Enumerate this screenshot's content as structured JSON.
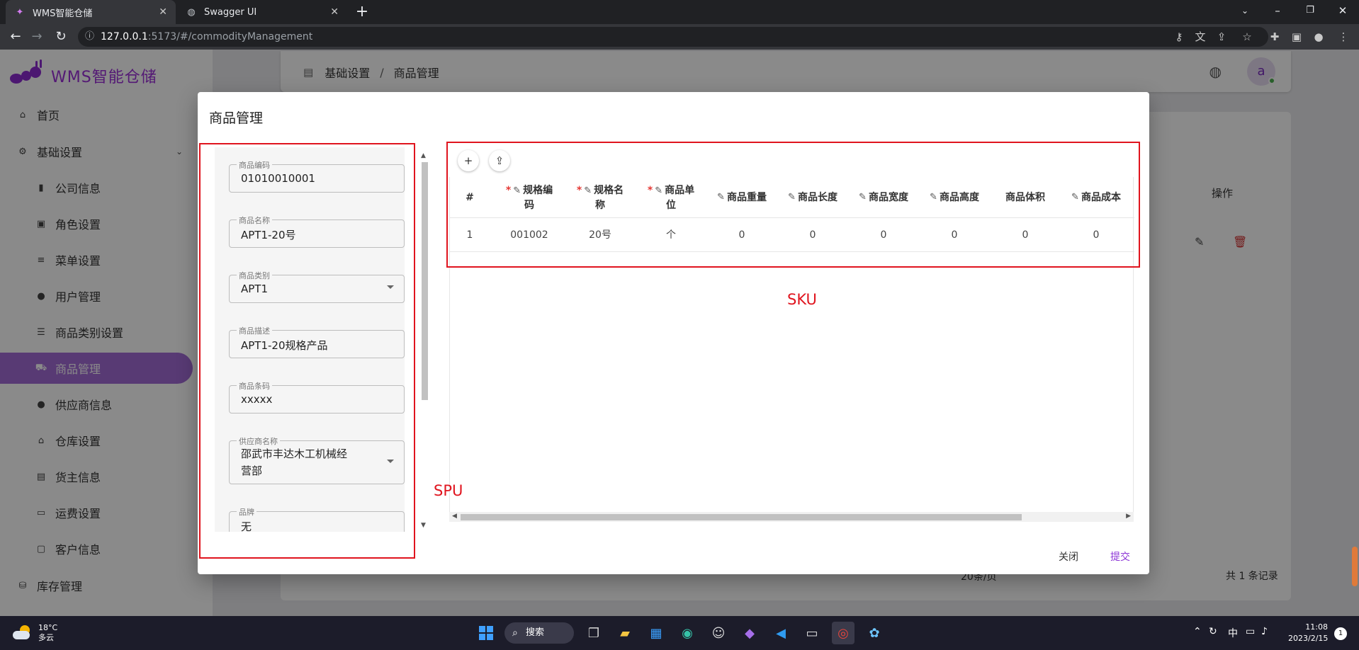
{
  "browser": {
    "tabs": [
      {
        "title": "WMS智能仓储",
        "icon": "ant-icon",
        "active": true
      },
      {
        "title": "Swagger UI",
        "icon": "globe-icon",
        "active": false
      }
    ],
    "url_host": "127.0.0.1",
    "url_rest": ":5173/#/commodityManagement"
  },
  "app": {
    "logo_text": "WMS智能仓储",
    "breadcrumb": [
      "基础设置",
      "商品管理"
    ],
    "avatar_letter": "a",
    "ops_header": "操作",
    "pager_total": "共 1 条记录",
    "pager_size": "20条/页"
  },
  "sidebar": {
    "items": [
      {
        "label": "首页",
        "icon": "home-icon",
        "level": "top"
      },
      {
        "label": "基础设置",
        "icon": "gear-icon",
        "level": "top",
        "expanded": true
      },
      {
        "label": "公司信息",
        "icon": "building-icon",
        "level": "sub"
      },
      {
        "label": "角色设置",
        "icon": "id-card-icon",
        "level": "sub"
      },
      {
        "label": "菜单设置",
        "icon": "menu-icon",
        "level": "sub"
      },
      {
        "label": "用户管理",
        "icon": "person-icon",
        "level": "sub"
      },
      {
        "label": "商品类别设置",
        "icon": "list-icon",
        "level": "sub"
      },
      {
        "label": "商品管理",
        "icon": "cart-icon",
        "level": "sub",
        "active": true
      },
      {
        "label": "供应商信息",
        "icon": "supplier-icon",
        "level": "sub"
      },
      {
        "label": "仓库设置",
        "icon": "warehouse-icon",
        "level": "sub"
      },
      {
        "label": "货主信息",
        "icon": "owner-icon",
        "level": "sub"
      },
      {
        "label": "运费设置",
        "icon": "money-icon",
        "level": "sub"
      },
      {
        "label": "客户信息",
        "icon": "customer-icon",
        "level": "sub"
      },
      {
        "label": "库存管理",
        "icon": "stock-icon",
        "level": "top"
      }
    ]
  },
  "dialog": {
    "title": "商品管理",
    "spu_fields": [
      {
        "label": "商品编码",
        "value": "01010010001"
      },
      {
        "label": "商品名称",
        "value": "APT1-20号"
      },
      {
        "label": "商品类别",
        "value": "APT1"
      },
      {
        "label": "商品描述",
        "value": "APT1-20规格产品"
      },
      {
        "label": "商品条码",
        "value": "xxxxx"
      },
      {
        "label": "供应商名称",
        "value": "邵武市丰达木工机械经营部"
      },
      {
        "label": "品牌",
        "value": "无"
      }
    ],
    "sku_columns": [
      "#",
      "规格编码",
      "规格名称",
      "商品单位",
      "商品重量",
      "商品长度",
      "商品宽度",
      "商品高度",
      "商品体积",
      "商品成本"
    ],
    "sku_rows": [
      [
        "1",
        "001002",
        "20号",
        "个",
        "0",
        "0",
        "0",
        "0",
        "0",
        "0"
      ]
    ],
    "close_label": "关闭",
    "submit_label": "提交"
  },
  "annotations": {
    "spu_label": "SPU",
    "sku_label": "SKU",
    "color": "#e0141e"
  },
  "taskbar": {
    "weather_temp": "18°C",
    "weather_desc": "多云",
    "search_label": "搜索",
    "ime": "中",
    "time": "11:08",
    "date": "2023/2/15",
    "notifications": "1"
  }
}
